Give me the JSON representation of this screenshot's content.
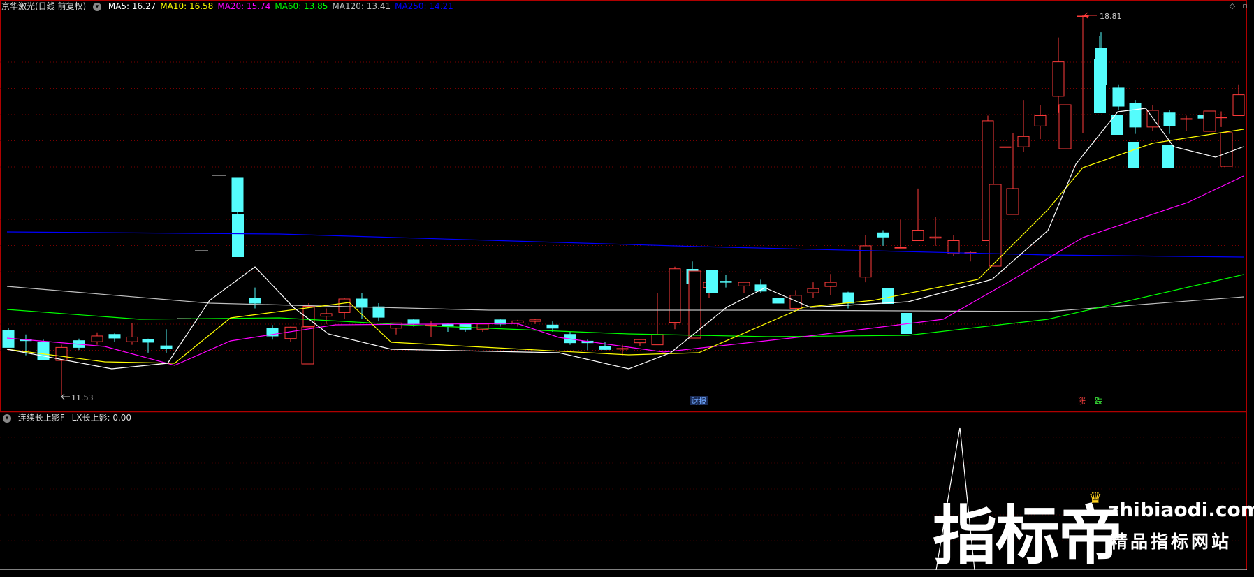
{
  "main_panel": {
    "title": "京华激光(日线 前复权)",
    "ma_labels": [
      {
        "name": "MA5",
        "value": "16.27",
        "color": "#ffffff"
      },
      {
        "name": "MA10",
        "value": "16.58",
        "color": "#ffff00"
      },
      {
        "name": "MA20",
        "value": "15.74",
        "color": "#ff00ff"
      },
      {
        "name": "MA60",
        "value": "13.85",
        "color": "#00ff00"
      },
      {
        "name": "MA120",
        "value": "13.41",
        "color": "#c0c0c0"
      },
      {
        "name": "MA250",
        "value": "14.21",
        "color": "#0000ff"
      }
    ],
    "high_marker": "18.81",
    "low_marker": "11.53",
    "event_tags": [
      {
        "text": "财报",
        "color": "#6fa8ff",
        "bg": "#1a2b55"
      },
      {
        "text": "涨",
        "color": "#ff4040"
      },
      {
        "text": "跌",
        "color": "#40ff40"
      }
    ]
  },
  "sub_panel": {
    "title": "连续长上影F",
    "indicator_label": "LX长上影: 0.00"
  },
  "watermark": {
    "brand": "指标帝",
    "url": "zhibiaodi.com",
    "slogan": "精品指标网站"
  },
  "colors": {
    "up": "#ff3b3b",
    "down": "#54fcfc",
    "grid": "#7a0000",
    "frame": "#b00000"
  },
  "chart_data": {
    "type": "candlestick",
    "series": [
      {
        "name": "MA5"
      },
      {
        "name": "MA10"
      },
      {
        "name": "MA20"
      },
      {
        "name": "MA60"
      },
      {
        "name": "MA120"
      },
      {
        "name": "MA250"
      }
    ],
    "price_high": 18.81,
    "price_low": 11.53,
    "indicator_peak": 1
  }
}
